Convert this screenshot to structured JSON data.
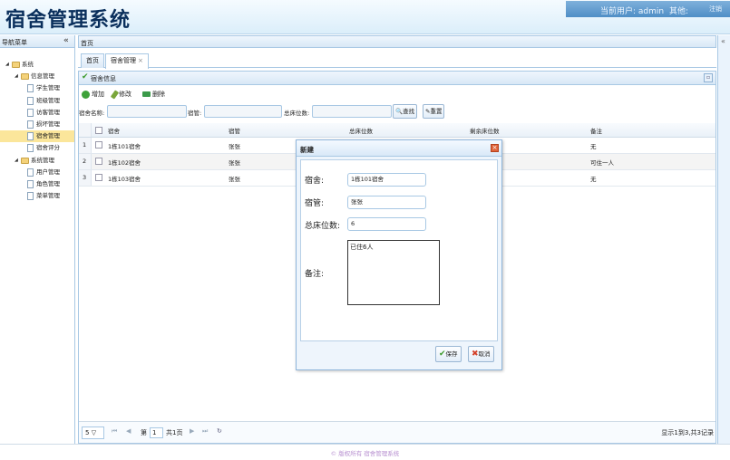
{
  "app_title": "宿舍管理系统",
  "userbar": {
    "current_user": "当前用户: admin",
    "other": "其他:",
    "logout": "注销"
  },
  "nav": {
    "title": "导航菜单",
    "collapse_icon": "«",
    "tree": [
      {
        "label": "系统",
        "level": 0,
        "type": "folder"
      },
      {
        "label": "信息管理",
        "level": 1,
        "type": "folder"
      },
      {
        "label": "学生管理",
        "level": 2,
        "type": "page"
      },
      {
        "label": "班级管理",
        "level": 2,
        "type": "page"
      },
      {
        "label": "访客管理",
        "level": 2,
        "type": "page"
      },
      {
        "label": "损坏管理",
        "level": 2,
        "type": "page"
      },
      {
        "label": "宿舍管理",
        "level": 2,
        "type": "page",
        "selected": true
      },
      {
        "label": "宿舍评分",
        "level": 2,
        "type": "page"
      },
      {
        "label": "系统管理",
        "level": 1,
        "type": "folder"
      },
      {
        "label": "用户管理",
        "level": 2,
        "type": "page"
      },
      {
        "label": "角色管理",
        "level": 2,
        "type": "page"
      },
      {
        "label": "菜单管理",
        "level": 2,
        "type": "page"
      }
    ]
  },
  "right_expand_icon": "«",
  "main": {
    "title": "首页",
    "tabs": [
      {
        "label": "首页"
      },
      {
        "label": "宿舍管理"
      }
    ],
    "tab_close": "×",
    "panel_title": "宿舍信息",
    "toolbar": {
      "add": "增加",
      "edit": "修改",
      "delete": "删除"
    },
    "search": {
      "name_label": "宿舍名称:",
      "manager_label": "宿管:",
      "beds_label": "总床位数:",
      "search_btn": "查找",
      "reset_btn": "重置"
    },
    "columns": [
      "宿舍",
      "宿管",
      "总床位数",
      "剩余床位数",
      "备注"
    ],
    "rows": [
      {
        "n": "1",
        "dorm": "1栋101宿舍",
        "manager": "张张",
        "note": "无"
      },
      {
        "n": "2",
        "dorm": "1栋102宿舍",
        "manager": "张张",
        "note": "可住一人"
      },
      {
        "n": "3",
        "dorm": "1栋103宿舍",
        "manager": "张张",
        "note": "无"
      }
    ],
    "pager": {
      "page_size": "5",
      "page_prefix": "第",
      "page_value": "1",
      "page_suffix": "共1页",
      "info": "显示1到3,共3记录"
    }
  },
  "dialog": {
    "title": "新建",
    "close": "×",
    "dorm_label": "宿舍:",
    "dorm_value": "1栋101宿舍",
    "manager_label": "宿管:",
    "manager_value": "张张",
    "beds_label": "总床位数:",
    "beds_value": "6",
    "note_label": "备注:",
    "note_value": "已住6人",
    "save": "保存",
    "cancel": "取消"
  },
  "footer": "© 版权所有 宿舍管理系统",
  "colors": {
    "brand_title": "#0a2f5c",
    "userbar": "#4f8ec6",
    "selected": "#fbe69b",
    "border": "#a8c8e4"
  }
}
